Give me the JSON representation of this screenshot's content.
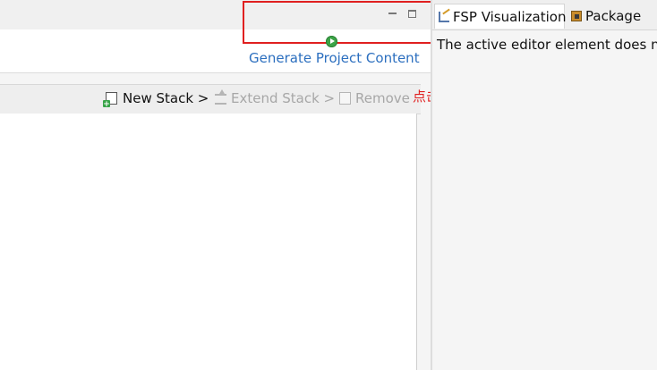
{
  "left_pane": {
    "generate_link": "Generate Project Content",
    "toolbar": {
      "new_stack": "New Stack >",
      "extend_stack": "Extend Stack >",
      "remove": "Remove"
    },
    "annotation_text": "点击生成配置",
    "annotation_color": "#e02020"
  },
  "right_pane": {
    "tabs": [
      {
        "label": "FSP Visualization",
        "icon": "fsp-visualization-icon",
        "active": true
      },
      {
        "label": "Package",
        "icon": "package-icon",
        "active": false
      }
    ],
    "message": "The active editor element does no"
  },
  "colors": {
    "link": "#2c6fbf",
    "highlight_box": "#e02020",
    "run_icon": "#3ca447"
  }
}
